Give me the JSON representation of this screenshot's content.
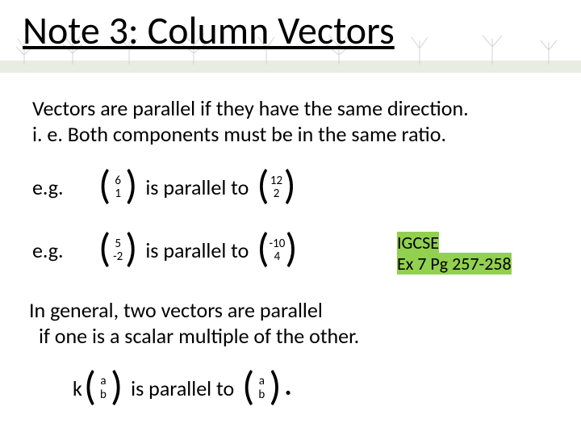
{
  "title": "Note 3: Column Vectors",
  "line1": "Vectors are parallel if they have the same direction.",
  "line2": "i. e.  Both components must be in the same ratio.",
  "eg_label": "e.g.",
  "parallel_text": "is parallel to",
  "vectors": {
    "v1": {
      "top": "6",
      "bot": "1"
    },
    "v2": {
      "top": "12",
      "bot": "2"
    },
    "v3": {
      "top": "5",
      "bot": "-2"
    },
    "v4": {
      "top": "-10",
      "bot": "4"
    },
    "va": {
      "top": "a",
      "bot": "b"
    },
    "vb": {
      "top": "a",
      "bot": "b"
    }
  },
  "note": {
    "l1": "IGCSE",
    "l2": "Ex 7  Pg 257-258"
  },
  "general1": "In general, two vectors are parallel",
  "general2": "if one is a scalar multiple of the other.",
  "k": "k",
  "dot": "."
}
